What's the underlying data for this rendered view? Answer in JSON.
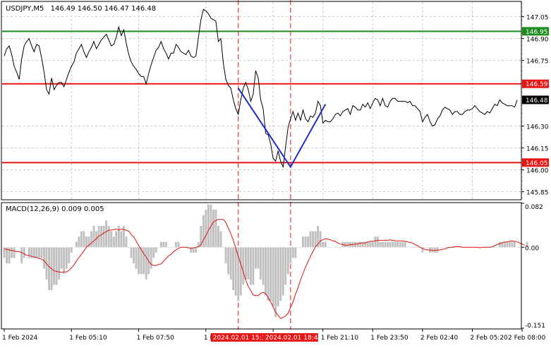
{
  "header": {
    "symbol": "USDJPY,M5",
    "ohlc": "146.49 146.50 146.47 146.48"
  },
  "macd": {
    "label": "MACD(12,26,9) 0.009 0.005",
    "ticks": [
      "0.082",
      "0.00",
      "-0.151"
    ]
  },
  "time_labels": [
    "1 Feb 2024",
    "1 Feb 05:10",
    "1 Feb 07:50",
    "1 Feb 10:30",
    "1 Feb 1",
    "1 Feb 21:10",
    "1 Feb 23:50",
    "2 Feb 02:40",
    "2 Feb 05:20",
    "2 Feb 08:00"
  ],
  "highlight_time_labels": [
    "2024.02.01 15:30",
    "2024.02.01 18:45"
  ],
  "colors": {
    "price_line": "#000000",
    "grid": "#c8c8c8",
    "green_level": "#1e8c1e",
    "red_level": "#e81515",
    "blue_path": "#1a2bc8",
    "histogram": "#c0c0c0",
    "signal": "#e01010",
    "current_price_badge": "#000000"
  },
  "chart_data": [
    {
      "type": "line",
      "title": "USDJPY,M5",
      "ylim": [
        145.8,
        147.15
      ],
      "yticks": [
        147.05,
        146.9,
        146.75,
        146.3,
        146.15,
        146.0,
        145.85
      ],
      "ytick_labels": [
        "147.05",
        "146.90",
        "146.75",
        "146.30",
        "146.15",
        "146.00",
        "145.85"
      ],
      "levels": [
        {
          "label": "146.95",
          "value": 146.95,
          "color": "#1e8c1e"
        },
        {
          "label": "146.59",
          "value": 146.59,
          "color": "#e81515"
        },
        {
          "label": "146.05",
          "value": 146.05,
          "color": "#e81515"
        }
      ],
      "current_price": {
        "label": "146.48",
        "value": 146.48
      },
      "close": [
        146.78,
        146.83,
        146.85,
        146.79,
        146.71,
        146.67,
        146.62,
        146.76,
        146.85,
        146.88,
        146.9,
        146.85,
        146.81,
        146.86,
        146.85,
        146.77,
        146.67,
        146.55,
        146.52,
        146.63,
        146.55,
        146.58,
        146.6,
        146.6,
        146.57,
        146.62,
        146.67,
        146.71,
        146.74,
        146.8,
        146.83,
        146.86,
        146.81,
        146.77,
        146.81,
        146.84,
        146.88,
        146.83,
        146.86,
        146.89,
        146.91,
        146.93,
        146.89,
        146.85,
        146.86,
        146.91,
        146.98,
        146.92,
        146.96,
        146.87,
        146.79,
        146.74,
        146.71,
        146.69,
        146.66,
        146.64,
        146.64,
        146.59,
        146.66,
        146.72,
        146.77,
        146.82,
        146.84,
        146.88,
        146.83,
        146.8,
        146.76,
        146.8,
        146.8,
        146.86,
        146.84,
        146.81,
        146.8,
        146.79,
        146.82,
        146.78,
        146.77,
        146.78,
        146.91,
        147.03,
        147.1,
        147.09,
        147.07,
        147.04,
        147.03,
        147.02,
        146.88,
        146.9,
        146.73,
        146.62,
        146.58,
        146.56,
        146.48,
        146.42,
        146.38,
        146.48,
        146.56,
        146.6,
        146.55,
        146.47,
        146.52,
        146.68,
        146.63,
        146.48,
        146.42,
        146.25,
        146.24,
        146.18,
        146.08,
        146.06,
        146.13,
        146.06,
        146.02,
        146.16,
        146.29,
        146.35,
        146.4,
        146.34,
        146.39,
        146.34,
        146.41,
        146.35,
        146.33,
        146.37,
        146.36,
        146.39,
        146.47,
        146.44,
        146.32,
        146.34,
        146.33,
        146.33,
        146.35,
        146.38,
        146.39,
        146.37,
        146.4,
        146.41,
        146.42,
        146.38,
        146.44,
        146.43,
        146.41,
        146.41,
        146.45,
        146.43,
        146.46,
        146.42,
        146.46,
        146.49,
        146.48,
        146.44,
        146.49,
        146.44,
        146.43,
        146.47,
        146.49,
        146.49,
        146.47,
        146.47,
        146.47,
        146.47,
        146.46,
        146.47,
        146.44,
        146.44,
        146.42,
        146.4,
        146.33,
        146.36,
        146.38,
        146.33,
        146.3,
        146.31,
        146.35,
        146.37,
        146.41,
        146.43,
        146.42,
        146.41,
        146.38,
        146.4,
        146.4,
        146.38,
        146.38,
        146.4,
        146.41,
        146.41,
        146.42,
        146.44,
        146.42,
        146.4,
        146.39,
        146.38,
        146.4,
        146.39,
        146.42,
        146.45,
        146.44,
        146.48,
        146.46,
        146.45,
        146.44,
        146.44,
        146.44,
        146.43,
        146.48
      ],
      "annotation_path": [
        {
          "index": 94,
          "value": 146.56
        },
        {
          "index": 115,
          "value": 146.02
        },
        {
          "index": 129,
          "value": 146.45
        }
      ],
      "highlight_indices": [
        94,
        115
      ],
      "time_tick_indices": [
        0,
        27,
        54,
        81,
        108,
        128,
        148,
        168,
        188,
        208
      ]
    },
    {
      "type": "bar",
      "title": "MACD(12,26,9)",
      "ylim": [
        -0.151,
        0.082
      ],
      "yticks": [
        0.082,
        0.0,
        -0.151
      ],
      "histogram": [
        -0.02,
        -0.03,
        -0.03,
        -0.02,
        -0.02,
        0.0,
        0.0,
        -0.03,
        -0.02,
        0.0,
        -0.02,
        -0.02,
        -0.02,
        -0.02,
        -0.02,
        -0.02,
        -0.04,
        -0.06,
        -0.08,
        -0.08,
        -0.07,
        -0.07,
        -0.06,
        -0.04,
        -0.05,
        -0.04,
        -0.03,
        -0.01,
        0.0,
        0.01,
        0.02,
        0.03,
        0.03,
        0.02,
        0.02,
        0.03,
        0.04,
        0.03,
        0.04,
        0.04,
        0.04,
        0.05,
        0.04,
        0.03,
        0.02,
        0.03,
        0.04,
        0.03,
        0.04,
        0.02,
        0.0,
        -0.02,
        -0.03,
        -0.04,
        -0.05,
        -0.05,
        -0.05,
        -0.06,
        -0.05,
        -0.04,
        -0.02,
        -0.01,
        0.0,
        0.01,
        0.01,
        0.01,
        0.0,
        0.0,
        0.0,
        0.01,
        0.01,
        0.0,
        0.0,
        -0.0,
        -0.0,
        -0.01,
        -0.01,
        -0.01,
        0.01,
        0.04,
        0.06,
        0.07,
        0.08,
        0.08,
        0.07,
        0.07,
        0.04,
        0.03,
        0.0,
        -0.03,
        -0.05,
        -0.06,
        -0.08,
        -0.09,
        -0.1,
        -0.09,
        -0.07,
        -0.06,
        -0.06,
        -0.07,
        -0.07,
        -0.04,
        -0.04,
        -0.06,
        -0.07,
        -0.09,
        -0.1,
        -0.1,
        -0.11,
        -0.13,
        -0.11,
        -0.1,
        -0.09,
        -0.07,
        -0.05,
        -0.03,
        -0.02,
        -0.02,
        0.0,
        0.0,
        0.02,
        0.02,
        0.02,
        0.03,
        0.03,
        0.03,
        0.04,
        0.03,
        0.01,
        0.01,
        0.0,
        0.0,
        0.0,
        0.0,
        0.0,
        0.0,
        0.01,
        0.01,
        0.01,
        0.01,
        0.01,
        0.01,
        0.01,
        0.01,
        0.01,
        0.01,
        0.01,
        0.01,
        0.01,
        0.02,
        0.02,
        0.01,
        0.01,
        0.01,
        0.01,
        0.01,
        0.01,
        0.01,
        0.01,
        0.01,
        0.01,
        0.01,
        0.0,
        0.0,
        0.0,
        0.0,
        -0.0,
        -0.0,
        -0.01,
        -0.0,
        -0.0,
        -0.01,
        -0.01,
        -0.01,
        -0.01,
        -0.0,
        0.0,
        0.0,
        0.0,
        0.0,
        0.0,
        0.0,
        0.0,
        0.0,
        0.0,
        0.0,
        0.0,
        0.0,
        0.0,
        0.0,
        0.0,
        0.0,
        0.0,
        0.0,
        0.0,
        0.0,
        0.0,
        0.0,
        0.0,
        0.01,
        0.01,
        0.01,
        0.01,
        0.01,
        0.01,
        0.01,
        0.0,
        0.0,
        0.0,
        0.0,
        0.01
      ],
      "signal": [
        -0.003,
        -0.004,
        -0.005,
        -0.006,
        -0.007,
        -0.008,
        -0.008,
        -0.01,
        -0.012,
        -0.015,
        -0.015,
        -0.017,
        -0.018,
        -0.019,
        -0.021,
        -0.022,
        -0.025,
        -0.031,
        -0.036,
        -0.04,
        -0.044,
        -0.045,
        -0.046,
        -0.047,
        -0.046,
        -0.046,
        -0.043,
        -0.038,
        -0.033,
        -0.026,
        -0.019,
        -0.013,
        -0.007,
        -0.0,
        0.004,
        0.008,
        0.012,
        0.016,
        0.021,
        0.023,
        0.027,
        0.029,
        0.032,
        0.032,
        0.033,
        0.034,
        0.032,
        0.034,
        0.033,
        0.032,
        0.03,
        0.024,
        0.019,
        0.012,
        0.003,
        -0.004,
        -0.012,
        -0.018,
        -0.026,
        -0.032,
        -0.034,
        -0.034,
        -0.032,
        -0.031,
        -0.026,
        -0.021,
        -0.016,
        -0.013,
        -0.008,
        -0.005,
        -0.002,
        -0.0,
        0.0,
        0.0,
        -0.001,
        -0.002,
        -0.001,
        -0.0,
        0.001,
        0.005,
        0.014,
        0.022,
        0.032,
        0.039,
        0.047,
        0.05,
        0.052,
        0.052,
        0.052,
        0.046,
        0.036,
        0.025,
        0.013,
        -0.002,
        -0.017,
        -0.031,
        -0.046,
        -0.061,
        -0.073,
        -0.081,
        -0.089,
        -0.09,
        -0.09,
        -0.086,
        -0.084,
        -0.087,
        -0.094,
        -0.102,
        -0.111,
        -0.121,
        -0.127,
        -0.133,
        -0.131,
        -0.128,
        -0.123,
        -0.112,
        -0.102,
        -0.087,
        -0.076,
        -0.061,
        -0.049,
        -0.037,
        -0.027,
        -0.017,
        -0.008,
        0.001,
        0.006,
        0.012,
        0.014,
        0.016,
        0.015,
        0.014,
        0.012,
        0.011,
        0.008,
        0.006,
        0.005,
        0.004,
        0.004,
        0.005,
        0.005,
        0.006,
        0.006,
        0.008,
        0.008,
        0.008,
        0.01,
        0.011,
        0.011,
        0.012,
        0.013,
        0.013,
        0.013,
        0.013,
        0.013,
        0.014,
        0.013,
        0.012,
        0.012,
        0.012,
        0.012,
        0.011,
        0.01,
        0.009,
        0.008,
        0.005,
        0.003,
        0.0,
        -0.002,
        -0.004,
        -0.005,
        -0.005,
        -0.006,
        -0.006,
        -0.005,
        -0.005,
        -0.004,
        -0.003,
        -0.001,
        -0.0,
        0.0,
        0.001,
        0.001,
        0.001,
        0.0,
        0.0,
        -0.0,
        -0.0,
        -0.0,
        -0.0,
        -0.0,
        -0.001,
        -0.0,
        -0.0,
        0.0,
        0.0,
        0.001,
        0.003,
        0.005,
        0.007,
        0.008,
        0.01,
        0.01,
        0.011,
        0.012,
        0.011,
        0.01,
        0.008,
        0.006,
        0.004
      ]
    }
  ]
}
